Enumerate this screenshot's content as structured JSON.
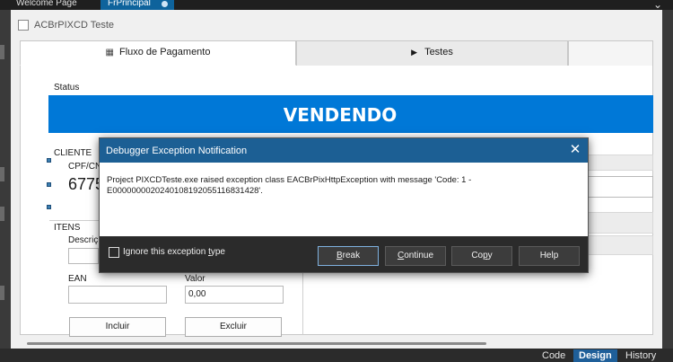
{
  "ide": {
    "tabs": [
      {
        "label": "Welcome Page"
      },
      {
        "label": "FrPrincipal"
      }
    ],
    "bottom_tabs": [
      {
        "label": "Code"
      },
      {
        "label": "Design"
      },
      {
        "label": "History"
      }
    ],
    "accent_color": "#0e639c"
  },
  "form": {
    "title": "ACBrPIXCD Teste",
    "tabs": [
      {
        "label": "Fluxo de Pagamento",
        "icon": "qr-code-icon"
      },
      {
        "label": "Testes",
        "icon": "play-icon"
      }
    ],
    "status": {
      "label": "Status",
      "value": "VENDENDO",
      "color": "#0078d7"
    },
    "cliente": {
      "label": "CLIENTE",
      "cpf_label": "CPF/CNP",
      "cpf_value": "6775"
    },
    "itens": {
      "label": "ITENS",
      "descricao_label": "Descriç",
      "ean_label": "EAN",
      "valor_label": "Valor",
      "valor_value": "0,00",
      "incluir_label": "Incluir",
      "excluir_label": "Excluir"
    }
  },
  "dialog": {
    "title": "Debugger Exception Notification",
    "close_glyph": "✕",
    "message": "Project PIXCDTeste.exe raised exception class EACBrPixHttpException with message 'Code: 1 - E00000000202401081920551168314​28'.",
    "ignore_label_pre": "Ignore this exception ",
    "ignore_label_ul": "t",
    "ignore_label_post": "ype",
    "buttons": {
      "break_ul": "B",
      "break_rest": "reak",
      "continue_ul": "C",
      "continue_rest": "ontinue",
      "copy_pre": "Co",
      "copy_ul": "p",
      "copy_post": "y",
      "help": "Help"
    },
    "header_color": "#1c5f94"
  }
}
